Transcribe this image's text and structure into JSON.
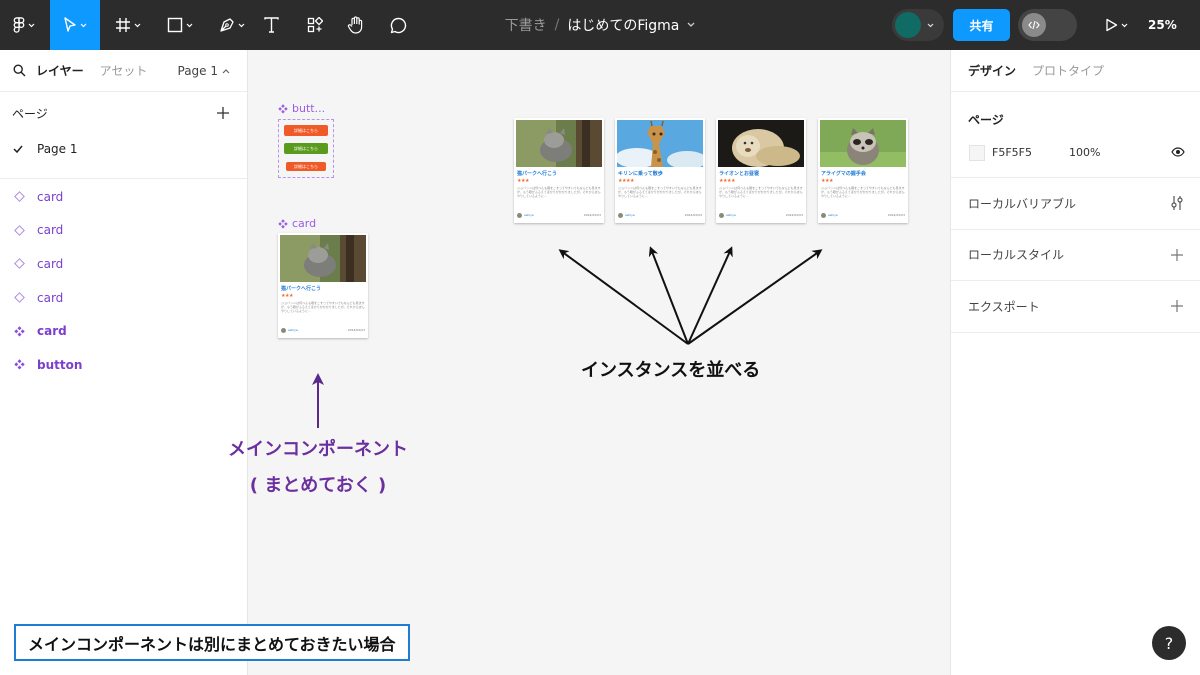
{
  "toolbar": {
    "breadcrumb_draft": "下書き",
    "breadcrumb_sep": "/",
    "file_name": "はじめてのFigma",
    "share_label": "共有",
    "zoom": "25%",
    "active_tool": "move-tool",
    "accent_color": "#0d99ff",
    "tools": [
      "figma-menu",
      "move-tool",
      "frame-tool",
      "shape-tool",
      "pen-tool",
      "text-tool",
      "resources-tool",
      "hand-tool",
      "comment-tool"
    ]
  },
  "left_panel": {
    "tab_layers": "レイヤー",
    "tab_assets": "アセット",
    "page_selector": "Page 1",
    "pages_heading": "ページ",
    "pages": [
      {
        "label": "Page 1",
        "selected": true
      }
    ],
    "layers": [
      {
        "label": "card",
        "kind": "instance"
      },
      {
        "label": "card",
        "kind": "instance"
      },
      {
        "label": "card",
        "kind": "instance"
      },
      {
        "label": "card",
        "kind": "instance"
      },
      {
        "label": "card",
        "kind": "component"
      },
      {
        "label": "button",
        "kind": "component"
      }
    ]
  },
  "canvas": {
    "background": "#f5f5f5",
    "button_component_label": "butt...",
    "card_component_label": "card",
    "buttons": [
      {
        "label": "詳細はこちら",
        "color": "#f05a28"
      },
      {
        "label": "詳細はこちら",
        "color": "#5a9b1e"
      },
      {
        "label": "詳細はこちら",
        "color": "#f05a28"
      }
    ],
    "main_card": {
      "title": "猫パークへ行こう",
      "stars": "★★★",
      "body": "ジョバンニは何べんも眼をこすってやすいでもなんども見ますが、もう眼がふるえてほかりがかかりましたが。それからぼんやりしているように…",
      "user": "ashiya",
      "date": "2024/02/03",
      "image": "cat"
    },
    "instances": [
      {
        "title": "猫パークへ行こう",
        "stars": "★★★",
        "body": "ジョバンニは何べんも眼をこすってやすいでもなんども見ますが、もう眼がふるえてほかりがかかりましたが。それからぼんやりしているように…",
        "user": "ashiya",
        "date": "2024/02/03",
        "image": "cat"
      },
      {
        "title": "キリンに乗って散歩",
        "stars": "★★★★",
        "body": "ジョバンニは何べんも眼をこすってやすいでもなんども見ますが、もう眼がふるえてほかりがかかりましたが。それからぼんやりしているように…",
        "user": "ashiya",
        "date": "2024/02/03",
        "image": "giraffe"
      },
      {
        "title": "ライオンとお昼寝",
        "stars": "★★★★",
        "body": "ジョバンニは何べんも眼をこすってやすいでもなんども見ますが、もう眼がふるえてほかりがかかりましたが。それからぼんやりしているように…",
        "user": "ashiya",
        "date": "2024/02/03",
        "image": "lion"
      },
      {
        "title": "アライグマの握手会",
        "stars": "★★★",
        "body": "ジョバンニは何べんも眼をこすってやすいでもなんども見ますが、もう眼がふるえてほかりがかかりましたが。それからぼんやりしているように…",
        "user": "ashiya",
        "date": "2024/02/03",
        "image": "raccoon"
      }
    ],
    "annotation_main_line1": "メインコンポーネント",
    "annotation_main_line2": "( まとめておく )",
    "annotation_instances": "インスタンスを並べる",
    "annotation_color_purple": "#6c2fa0"
  },
  "right_panel": {
    "tab_design": "デザイン",
    "tab_prototype": "プロトタイプ",
    "page_heading": "ページ",
    "page_color_hex": "F5F5F5",
    "page_opacity": "100%",
    "local_variables": "ローカルバリアブル",
    "local_styles": "ローカルスタイル",
    "export": "エクスポート",
    "help": "?"
  },
  "caption": {
    "text": "メインコンポーネントは別にまとめておきたい場合",
    "border_color": "#1f7bd6"
  }
}
